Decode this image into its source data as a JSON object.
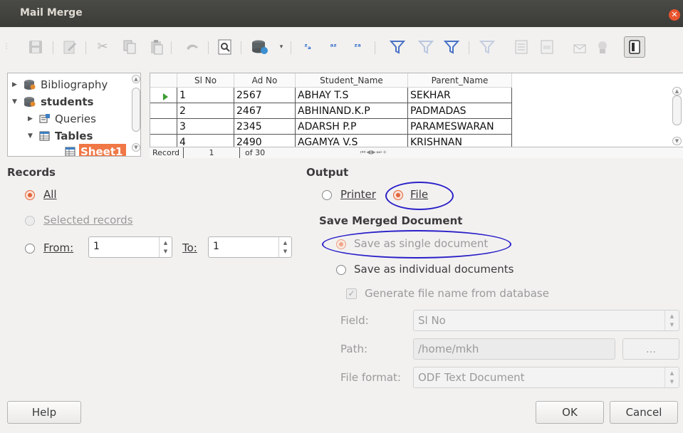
{
  "window": {
    "title": "Mail Merge"
  },
  "tree": {
    "items": [
      {
        "label": "Bibliography"
      },
      {
        "label": "students"
      },
      {
        "label": "Queries"
      },
      {
        "label": "Tables"
      },
      {
        "label": "Sheet1"
      }
    ]
  },
  "grid": {
    "columns": [
      "Sl No",
      "Ad No",
      "Student_Name",
      "Parent_Name"
    ],
    "rows": [
      [
        "1",
        "2567",
        "ABHAY T.S",
        "SEKHAR"
      ],
      [
        "2",
        "2467",
        "ABHINAND.K.P",
        "PADMADAS"
      ],
      [
        "3",
        "2345",
        "ADARSH P.P",
        "PARAMESWARAN"
      ],
      [
        "4",
        "2490",
        "AGAMYA V.S",
        "KRISHNAN"
      ]
    ],
    "nav": {
      "record_label": "Record",
      "current": "1",
      "of_text": "of 30"
    }
  },
  "records": {
    "heading": "Records",
    "all_label": "All",
    "selected_label": "Selected records",
    "from_label": "From:",
    "from_value": "1",
    "to_label": "To:",
    "to_value": "1"
  },
  "output": {
    "heading": "Output",
    "printer_label": "Printer",
    "file_label": "File",
    "save_heading": "Save Merged Document",
    "single_label": "Save as single document",
    "individual_label": "Save as individual documents",
    "generate_label": "Generate file name from database",
    "field_label": "Field:",
    "field_value": "Sl No",
    "path_label": "Path:",
    "path_value": "/home/mkh",
    "browse_label": "...",
    "format_label": "File format:",
    "format_value": "ODF Text Document"
  },
  "buttons": {
    "help": "Help",
    "ok": "OK",
    "cancel": "Cancel"
  },
  "colors": {
    "accent": "#e0643a",
    "annotation": "#2b20c8",
    "selection": "#f07746"
  }
}
